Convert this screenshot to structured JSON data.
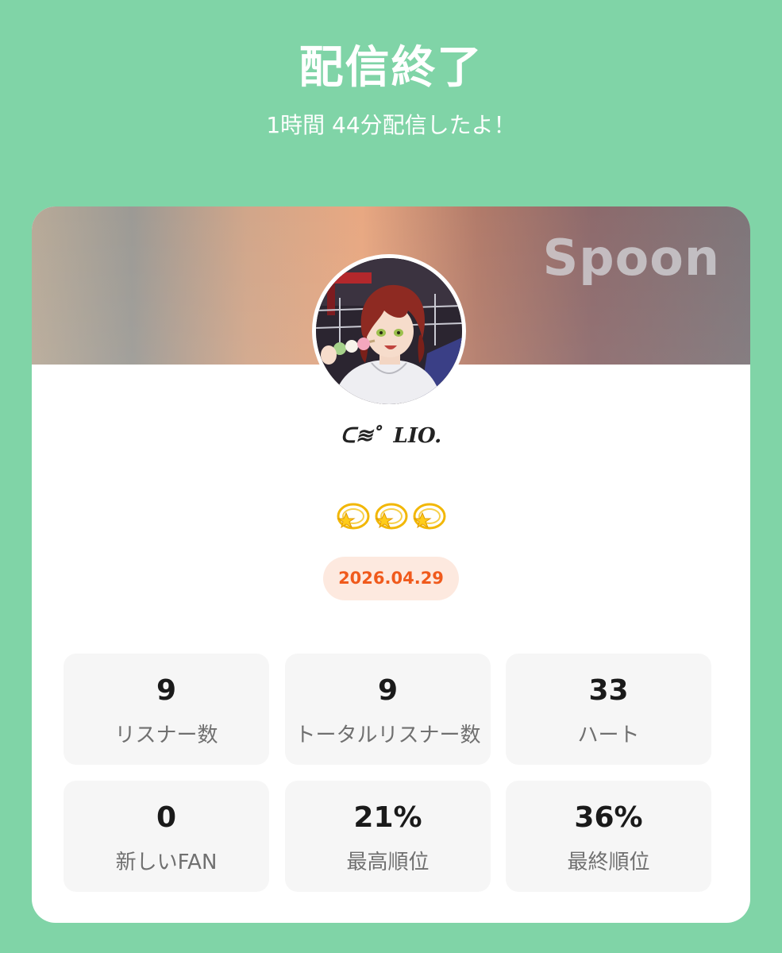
{
  "header": {
    "title": "配信終了",
    "duration_text": "1時間 44分配信したよ！"
  },
  "profile": {
    "brand_watermark": "Spoon",
    "username": "ᑕ≋゜LIO.",
    "emoji_icons": [
      "dizzy-star-icon",
      "dizzy-star-icon",
      "dizzy-star-icon"
    ],
    "date": "2026.04.29"
  },
  "stats": [
    {
      "value": "9",
      "label": "リスナー数"
    },
    {
      "value": "9",
      "label": "トータルリスナー数"
    },
    {
      "value": "33",
      "label": "ハート"
    },
    {
      "value": "0",
      "label": "新しいFAN"
    },
    {
      "value": "21%",
      "label": "最高順位"
    },
    {
      "value": "36%",
      "label": "最終順位"
    }
  ],
  "colors": {
    "background": "#80d4a7",
    "date_text": "#f05a1c",
    "date_pill": "#fde9df",
    "stat_card": "#f6f6f6"
  }
}
